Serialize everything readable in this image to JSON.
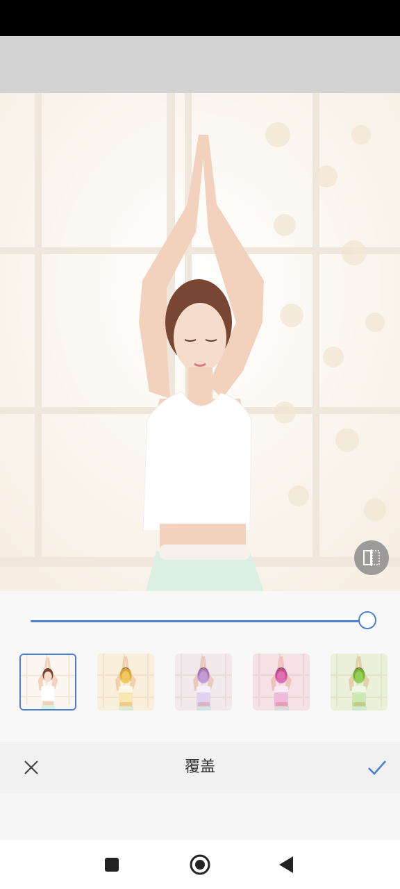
{
  "editor": {
    "title": "覆盖",
    "intensity": 1.0
  },
  "filters": [
    {
      "name": "original",
      "tint": "#ffffff",
      "selected": true
    },
    {
      "name": "gold",
      "tint": "#f0c040",
      "selected": false
    },
    {
      "name": "violet",
      "tint": "#b58ad8",
      "selected": false
    },
    {
      "name": "magenta",
      "tint": "#d850a8",
      "selected": false
    },
    {
      "name": "green",
      "tint": "#7ac83a",
      "selected": false
    }
  ],
  "colors": {
    "accent": "#4a7fd4"
  },
  "icons": {
    "compare": "compare-split-icon",
    "cancel": "close-icon",
    "confirm": "check-icon",
    "nav_recent": "square-icon",
    "nav_home": "circle-icon",
    "nav_back": "triangle-back-icon"
  }
}
